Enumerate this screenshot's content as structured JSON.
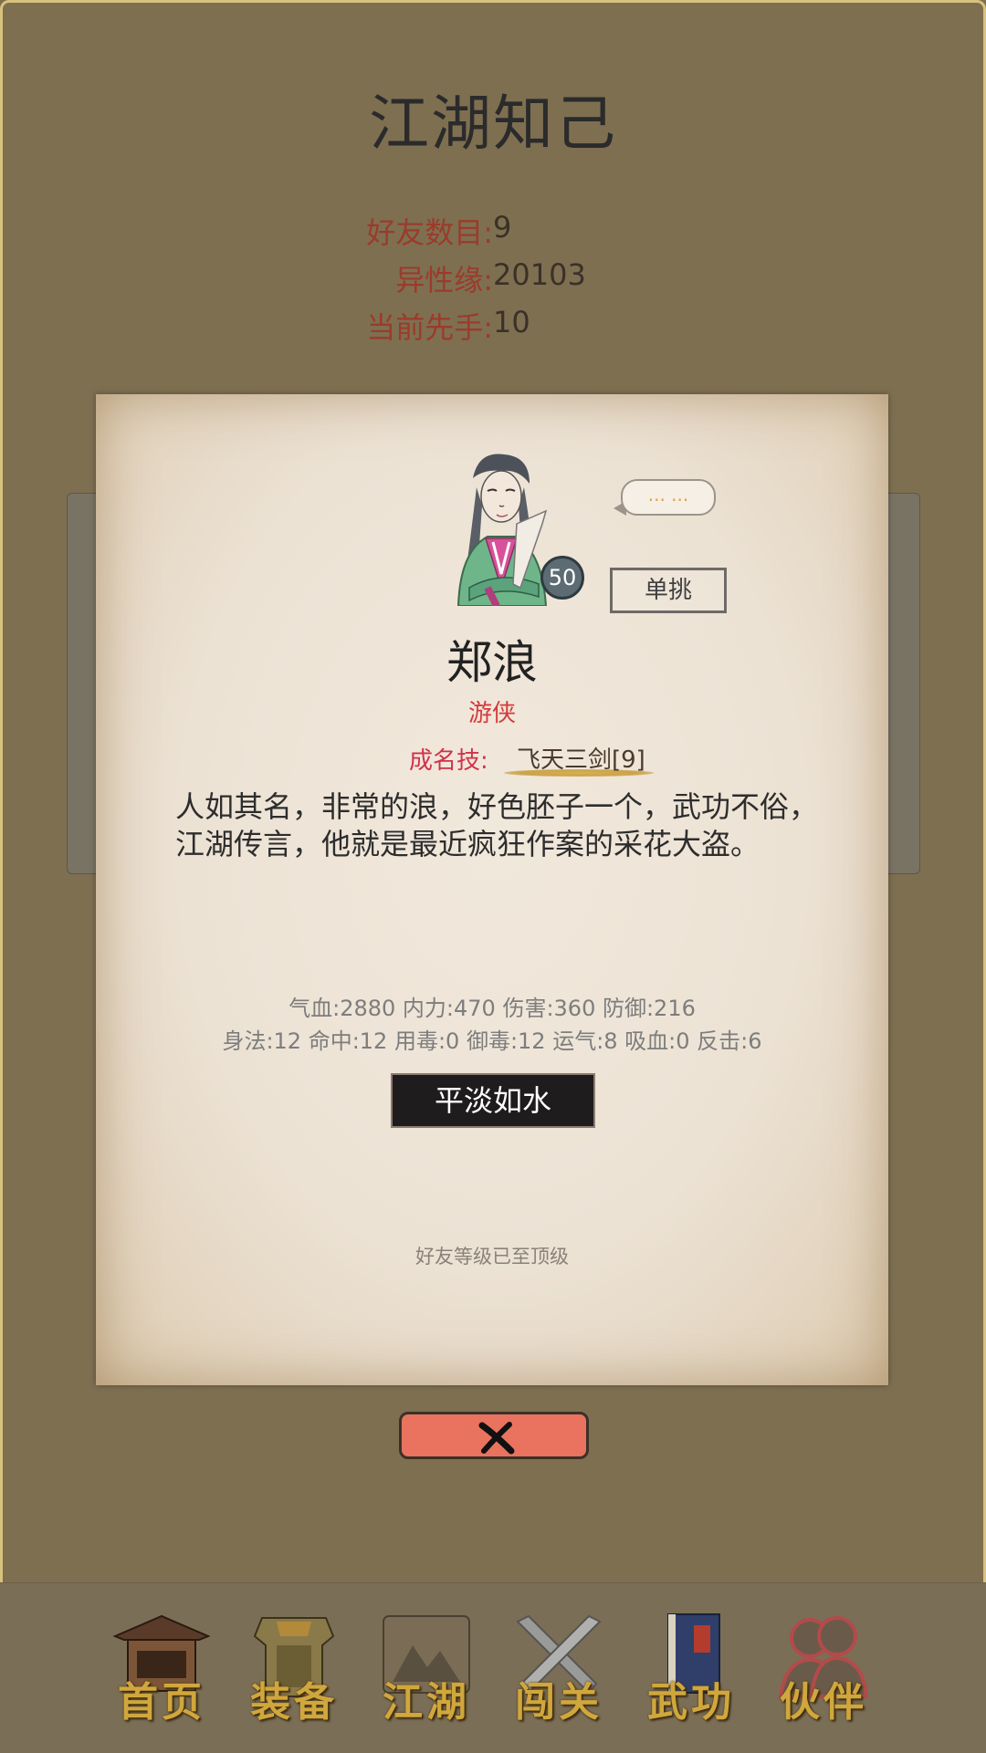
{
  "page": {
    "title": "江湖知己"
  },
  "summary": {
    "friends_label": "好友数目:",
    "friends_value": "9",
    "charm_label": "异性缘:",
    "charm_value": "20103",
    "initiative_label": "当前先手:",
    "initiative_value": "10"
  },
  "character": {
    "level": "50",
    "speech": "... ...",
    "duel_label": "单挑",
    "name": "郑浪",
    "title": "游侠",
    "skill_label": "成名技:",
    "skill_name": "飞天三剑[9]",
    "description": "人如其名，非常的浪，好色胚子一个，武功不俗，江湖传言，他就是最近疯狂作案的采花大盗。",
    "stats_line1": "气血:2880  内力:470  伤害:360  防御:216",
    "stats_line2": "身法:12  命中:12  用毒:0  御毒:12  运气:8  吸血:0  反击:6",
    "relation": "平淡如水",
    "status_note": "好友等级已至顶级"
  },
  "nav": {
    "items": [
      {
        "label": "首页",
        "icon": "house-icon"
      },
      {
        "label": "装备",
        "icon": "armor-icon"
      },
      {
        "label": "江湖",
        "icon": "scroll-map-icon"
      },
      {
        "label": "闯关",
        "icon": "crossed-swords-icon"
      },
      {
        "label": "武功",
        "icon": "martial-book-icon"
      },
      {
        "label": "伙伴",
        "icon": "companions-icon"
      }
    ],
    "active": "伙伴"
  },
  "colors": {
    "background": "#7e6f51",
    "label_red": "#9b3b2a",
    "close_button": "#e9735f",
    "nav_text_gold": "#d0a73d"
  }
}
